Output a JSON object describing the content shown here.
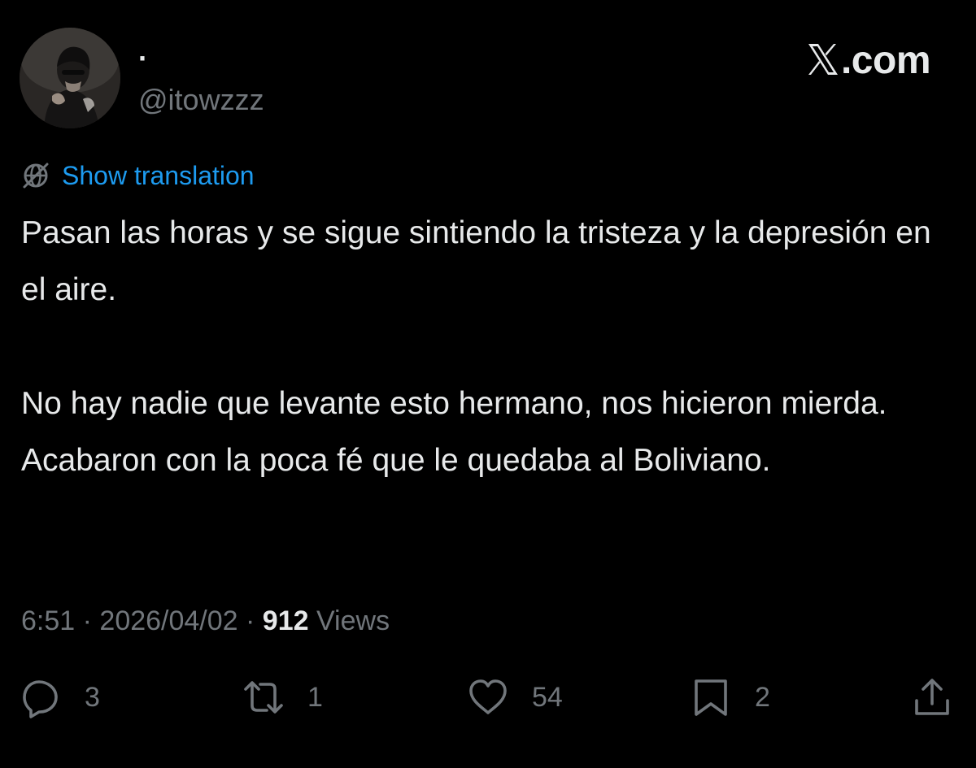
{
  "author": {
    "display_name": "·",
    "handle": "@itowzzz"
  },
  "brand": {
    "logo_icon": "x-logo-icon",
    "suffix": ".com"
  },
  "translation": {
    "icon": "globe-icon",
    "label": "Show translation"
  },
  "tweet": {
    "paragraph_1": "Pasan las horas y se sigue sintiendo la tristeza y la depresión en el aire.",
    "paragraph_2": "No hay nadie que levante esto hermano, nos hicieron mierda. Acabaron con la poca fé que le quedaba al Boliviano."
  },
  "meta": {
    "time": "6:51",
    "separator": " · ",
    "date": "2026/04/02",
    "views_count": "912",
    "views_label": "Views"
  },
  "actions": {
    "reply_count": "3",
    "repost_count": "1",
    "like_count": "54",
    "bookmark_count": "2"
  },
  "colors": {
    "background": "#000000",
    "text_primary": "#e7e9ea",
    "text_secondary": "#71767b",
    "link": "#1d9bf0"
  }
}
